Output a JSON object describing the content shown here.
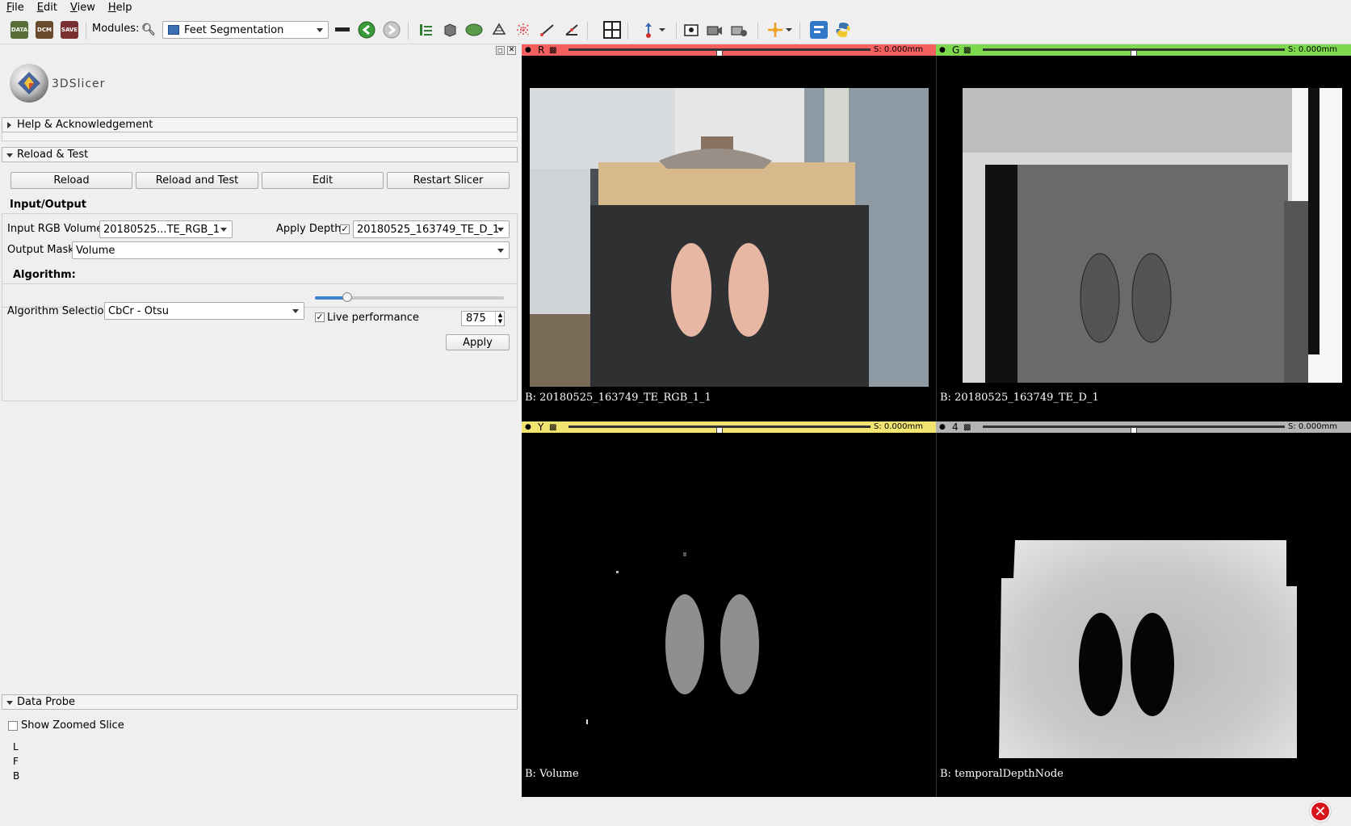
{
  "menu": {
    "items": [
      {
        "label": "File",
        "underline": "F",
        "rest": "ile"
      },
      {
        "label": "Edit",
        "underline": "E",
        "rest": "dit"
      },
      {
        "label": "View",
        "underline": "V",
        "rest": "iew"
      },
      {
        "label": "Help",
        "underline": "H",
        "rest": "elp"
      }
    ]
  },
  "toolbar": {
    "data_label": "DATA",
    "dcm_label": "DCM",
    "save_label": "SAVE",
    "modules_label": "Modules:",
    "module_selected": "Feet Segmentation"
  },
  "logo": {
    "text": "3DSlicer"
  },
  "sections": {
    "help": "Help & Acknowledgement",
    "reload": "Reload & Test",
    "data_probe": "Data Probe"
  },
  "reload_buttons": {
    "reload": "Reload",
    "reload_test": "Reload and Test",
    "edit": "Edit",
    "restart": "Restart Slicer"
  },
  "io": {
    "heading": "Input/Output",
    "input_rgb_label": "Input RGB Volume",
    "input_rgb_value": "20180525...TE_RGB_1",
    "apply_depth_label": "Apply Depth",
    "apply_depth_checked": "✓",
    "depth_value": "20180525_163749_TE_D_1",
    "output_mask_label": "Output Mask",
    "output_mask_value": "Volume"
  },
  "algorithm": {
    "heading": "Algorithm:",
    "selection_label": "Algorithm Selection",
    "selection_value": "CbCr - Otsu",
    "live_checked": "✓",
    "live_label": "Live performance",
    "spin_value": "875",
    "slider_level": 0.17,
    "apply_label": "Apply"
  },
  "probe": {
    "zoom_label": "Show Zoomed Slice",
    "rows": [
      "L",
      "F",
      "B"
    ]
  },
  "views": {
    "red": {
      "letter": "R",
      "offset": "S: 0.000mm",
      "caption": "B: 20180525_163749_TE_RGB_1_1",
      "slider": 0.5
    },
    "green": {
      "letter": "G",
      "offset": "S: 0.000mm",
      "caption": "B: 20180525_163749_TE_D_1",
      "slider": 0.5
    },
    "yellow": {
      "letter": "Y",
      "offset": "S: 0.000mm",
      "caption": "B: Volume",
      "slider": 0.5
    },
    "four": {
      "letter": "4",
      "offset": "S: 0.000mm",
      "caption": "B: temporalDepthNode",
      "slider": 0.5
    }
  },
  "colors": {
    "red": "#f46060",
    "green": "#7fd94f",
    "yellow": "#f2e470",
    "gray": "#b4b4b4"
  }
}
